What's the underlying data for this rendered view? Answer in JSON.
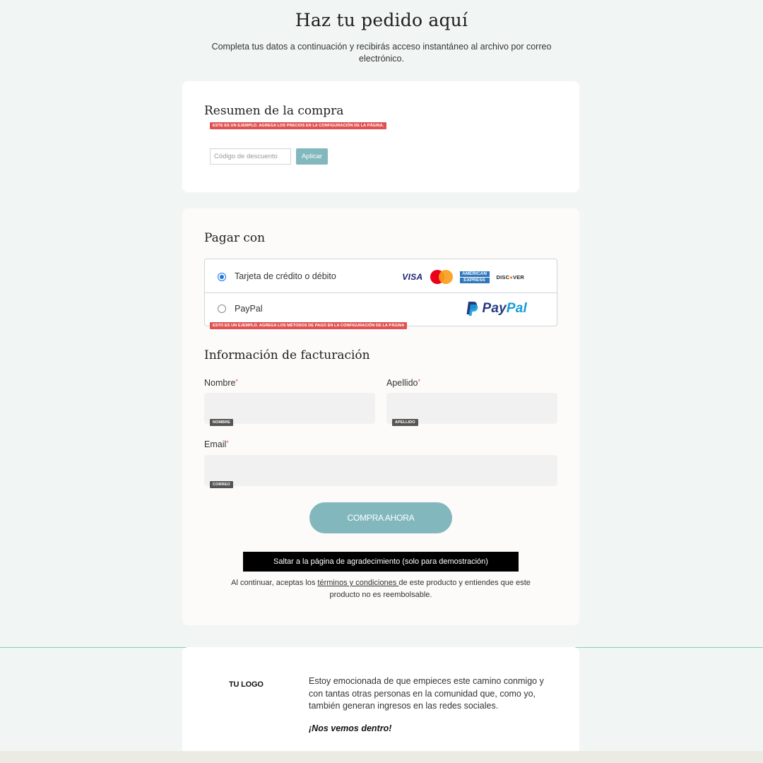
{
  "header": {
    "title": "Haz tu pedido aquí",
    "subtitle": "Completa tus datos a continuación y recibirás acceso instantáneo al archivo por correo electrónico."
  },
  "summary": {
    "title": "Resumen de la compra",
    "warning": "ESTE ES UN EJEMPLO. AGREGA LOS PRECIOS EN LA CONFIGURACIÓN DE LA PÁGINA.",
    "discount_placeholder": "Código de descuento",
    "apply_label": "Aplicar"
  },
  "payment": {
    "title": "Pagar con",
    "options": [
      {
        "label": "Tarjeta de crédito o débito",
        "selected": true
      },
      {
        "label": "PayPal",
        "selected": false
      }
    ],
    "card_brands": {
      "visa": "VISA",
      "amex_top": "AMERICAN",
      "amex_bottom": "EXPRESS",
      "discover_a": "DISC",
      "discover_b": "VER"
    },
    "paypal_brand": {
      "a": "Pay",
      "b": "Pal"
    },
    "warning": "ESTO ES UN EJEMPLO. AGREGA LOS MÉTODOS DE PAGO EN LA CONFIGURACIÓN DE LA PÁGINA"
  },
  "billing": {
    "title": "Información de facturación",
    "first_name_label": "Nombre",
    "last_name_label": "Apellido",
    "email_label": "Email",
    "required_mark": "*",
    "first_name_tag": "NOMBRE",
    "last_name_tag": "APELLIDO",
    "email_tag": "CORREO"
  },
  "actions": {
    "buy_label": "COMPRA AHORA",
    "demo_label": "Saltar a la página de agradecimiento (solo para demostración)",
    "terms_before": "Al continuar, aceptas los ",
    "terms_link": "términos y condiciones ",
    "terms_after": "de este producto y entiendes que este producto no es reembolsable."
  },
  "footer": {
    "logo": "TU LOGO",
    "text": "Estoy emocionada de que empieces este camino conmigo y con tantas otras personas en la comunidad que, como yo, también generan ingresos en las redes sociales.",
    "sign": "¡Nos vemos dentro!"
  },
  "colors": {
    "accent": "#82b8bd",
    "warning": "#e05252",
    "background": "#f1f6f4",
    "divider": "#86d1b6"
  }
}
